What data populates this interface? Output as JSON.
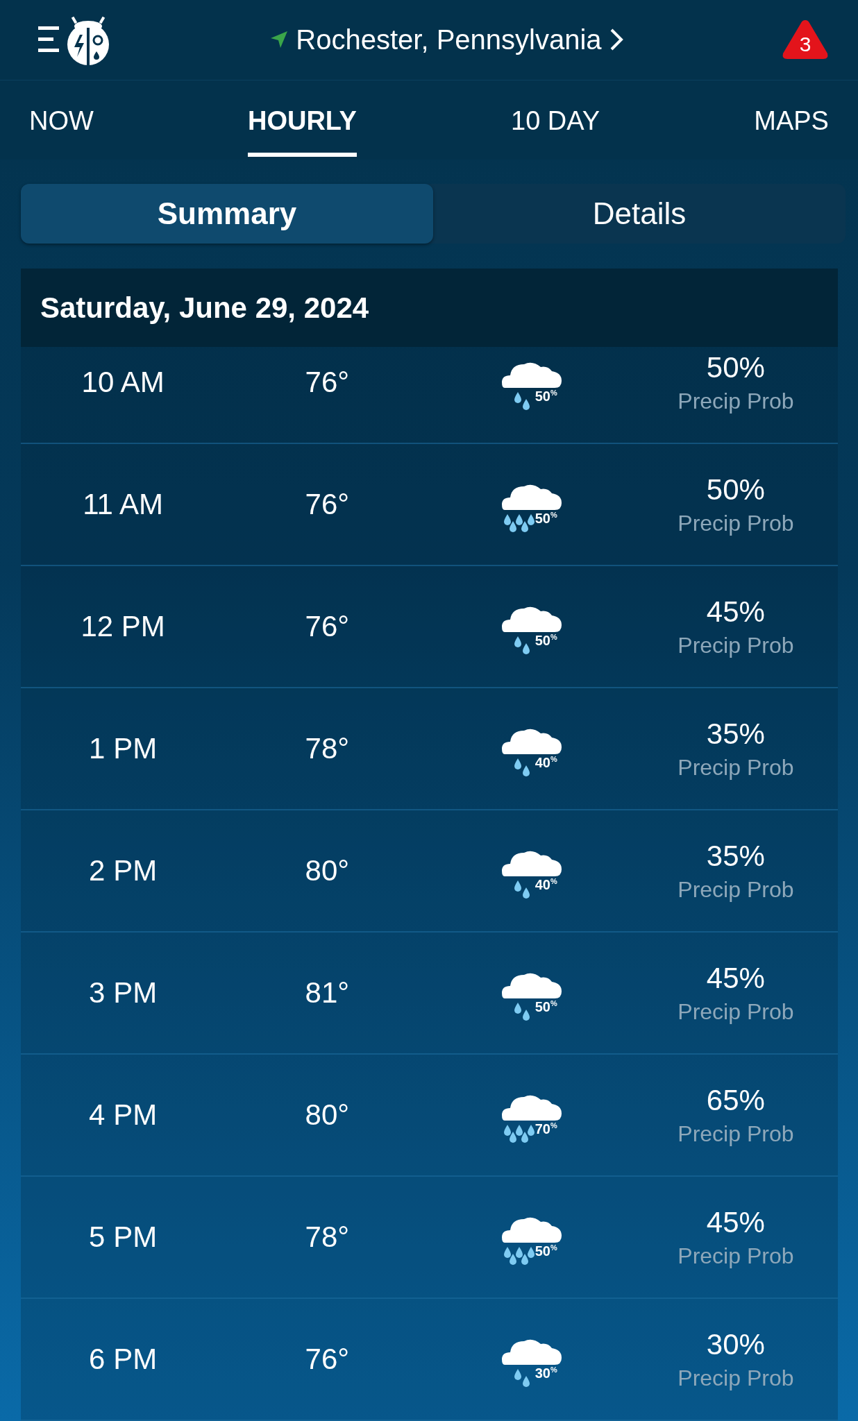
{
  "header": {
    "location": "Rochester,  Pennsylvania",
    "alert_count": "3"
  },
  "tabs": [
    {
      "label": "NOW",
      "selected": false
    },
    {
      "label": "HOURLY",
      "selected": true
    },
    {
      "label": "10  DAY",
      "selected": false
    },
    {
      "label": "MAPS",
      "selected": false
    }
  ],
  "segments": [
    {
      "label": "Summary",
      "selected": true
    },
    {
      "label": "Details",
      "selected": false
    }
  ],
  "day_header": "Saturday, June 29, 2024",
  "rows": [
    {
      "time": "10 AM",
      "temp": "76°",
      "kind": "light-rain",
      "icon_label": "50$^{%}$",
      "precip": "50%",
      "precip_label": "Precip Prob"
    },
    {
      "time": "11 AM",
      "temp": "76°",
      "kind": "heavy-rain",
      "icon_label": "50$^{%}$",
      "precip": "50%",
      "precip_label": "Precip Prob"
    },
    {
      "time": "12 PM",
      "temp": "76°",
      "kind": "light-rain",
      "icon_label": "50$^{%}$",
      "precip": "45%",
      "precip_label": "Precip Prob"
    },
    {
      "time": "1 PM",
      "temp": "78°",
      "kind": "light-rain",
      "icon_label": "40$^{%}$",
      "precip": "35%",
      "precip_label": "Precip Prob"
    },
    {
      "time": "2 PM",
      "temp": "80°",
      "kind": "light-rain",
      "icon_label": "40$^{%}$",
      "precip": "35%",
      "precip_label": "Precip Prob"
    },
    {
      "time": "3 PM",
      "temp": "81°",
      "kind": "light-rain",
      "icon_label": "50$^{%}$",
      "precip": "45%",
      "precip_label": "Precip Prob"
    },
    {
      "time": "4 PM",
      "temp": "80°",
      "kind": "heavy-rain",
      "icon_label": "70$^{%}$",
      "precip": "65%",
      "precip_label": "Precip Prob"
    },
    {
      "time": "5 PM",
      "temp": "78°",
      "kind": "heavy-rain",
      "icon_label": "50$^{%}$",
      "precip": "45%",
      "precip_label": "Precip Prob"
    },
    {
      "time": "6 PM",
      "temp": "76°",
      "kind": "light-rain",
      "icon_label": "30$^{%}$",
      "precip": "30%",
      "precip_label": "Precip Prob"
    }
  ]
}
